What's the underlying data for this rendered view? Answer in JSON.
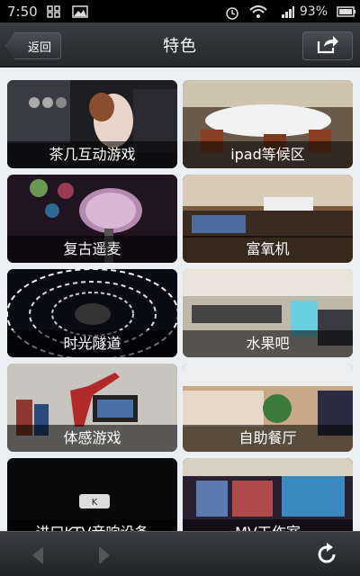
{
  "status": {
    "time": "7:50",
    "battery": "93%",
    "icons": [
      "grid-icon",
      "image-icon",
      "alarm-icon",
      "wifi-icon",
      "signal-3g-icon",
      "battery-icon"
    ]
  },
  "header": {
    "back_label": "返回",
    "title": "特色",
    "share_icon": "share-icon"
  },
  "tiles": [
    {
      "label": "茶几互动游戏"
    },
    {
      "label": "ipad等候区"
    },
    {
      "label": "复古遥麦"
    },
    {
      "label": "富氧机"
    },
    {
      "label": "时光隧道"
    },
    {
      "label": "水果吧"
    },
    {
      "label": "体感游戏"
    },
    {
      "label": "自助餐厅"
    },
    {
      "label": "进口KTV音响设备"
    },
    {
      "label": "MV工作室"
    }
  ],
  "bottom": {
    "icons": [
      "back-arrow-icon",
      "forward-arrow-icon",
      "refresh-icon"
    ]
  }
}
